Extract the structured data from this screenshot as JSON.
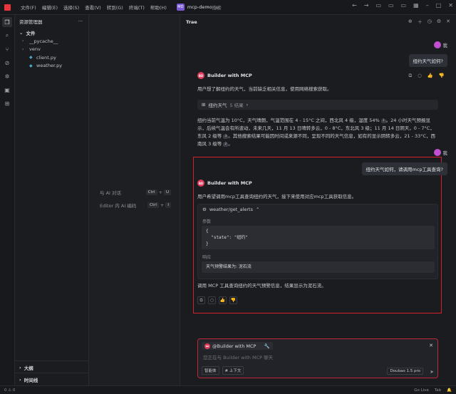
{
  "menu": [
    "文件(F)",
    "编辑(E)",
    "选择(S)",
    "查看(V)",
    "转到(G)",
    "终端(T)",
    "帮助(H)"
  ],
  "project": {
    "badge": "MD",
    "name": "mcp-demo"
  },
  "search": {
    "placeholder": "搜索"
  },
  "explorer": {
    "title": "资源管理器",
    "section": "文件",
    "items": [
      "__pycache__",
      "venv",
      "client.py",
      "weather.py"
    ],
    "outline": "大纲",
    "timeline": "时间线"
  },
  "editor": {
    "shortcut1_label": "与 AI 对话",
    "shortcut1_keys": [
      "Ctrl",
      "U"
    ],
    "shortcut2_label": "Editor 内 AI 编码",
    "shortcut2_keys": [
      "Ctrl",
      "I"
    ]
  },
  "chat": {
    "title": "Trae",
    "user_name": "我",
    "msg1": "纽约天气如何?",
    "bot_name": "Builder with MCP",
    "bot_logo": "BD",
    "reply1_intro": "用户想了解纽约的天气，当前缺乏相关信息，使用网络搜索获取。",
    "search_chip_label": "纽约天气",
    "search_chip_count": "5 结果",
    "reply1_body": "纽约当前气温为 10°C，天气晴朗，气温范围在 4 - 15°C 之间，西北风 4 级，湿度 54%",
    "cite1": "1",
    "reply1_body2": "。24 小时天气预报显示，后续气温会有所波动，未来几天，11 月 13 日晴转多云，0 - 8°C，东北风 3 级；11 月 14 日阴天，0 - 7°C，东风 2 级等",
    "cite2": "3",
    "reply1_body3": "。其他搜索结果可能因时间或来源不同，呈现不同的天气信息，如有的显示阴转多云，21 - 33°C，西南风 3 级等",
    "cite3": "2",
    "reply1_end": "。",
    "msg2": "纽约天气如何，请调用mcp工具查询?",
    "reply2_intro": "用户希望调用mcp工具查询纽约的天气，接下来使用对应mcp工具获取信息。",
    "tool_name": "weather/get_alerts",
    "params_label": "参数",
    "params_code": "{\n  \"state\": \"纽约\"\n}",
    "response_label": "响应",
    "response_text": "天气预警结果为: 泥石流",
    "reply2_summary": "调用 MCP 工具查询纽约的天气预警信息，结果显示为泥石流。"
  },
  "input": {
    "context_chip": "@Builder with MCP",
    "placeholder": "您正在与 Builder with MCP 聊天",
    "btn_agent": "智能体",
    "btn_context": "# 上下文",
    "model": "Doubao 1.5 pro"
  },
  "status": {
    "left": "0 ⚠ 0",
    "go_live": "Go Live",
    "tab": "Tab",
    "bell": "🔔"
  },
  "colors": {
    "accent": "#d3202a",
    "bot": "#e03c5b",
    "user": "#c04fd1"
  }
}
